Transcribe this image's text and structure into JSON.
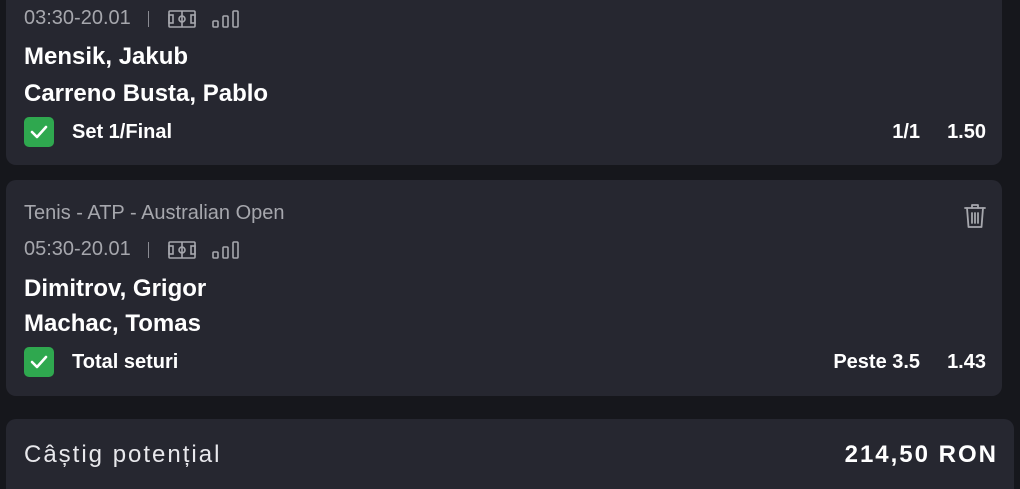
{
  "bets": [
    {
      "league": "",
      "time": "03:30-20.01",
      "home": "Mensik, Jakub",
      "away": "Carreno Busta, Pablo",
      "market": "Set 1/Final",
      "selection": "1/1",
      "odds": "1.50"
    },
    {
      "league": "Tenis - ATP - Australian Open",
      "time": "05:30-20.01",
      "home": "Dimitrov, Grigor",
      "away": "Machac, Tomas",
      "market": "Total seturi",
      "selection": "Peste 3.5",
      "odds": "1.43"
    }
  ],
  "summary": {
    "label": "Câștig potențial",
    "value": "214,50 RON"
  },
  "icons": {
    "field": "field-icon",
    "stats": "stats-icon",
    "check": "check-icon",
    "trash": "trash-icon"
  },
  "colors": {
    "background": "#16171c",
    "card": "#262730",
    "check": "#2fa84f",
    "muted_text": "#a6a7ad"
  }
}
